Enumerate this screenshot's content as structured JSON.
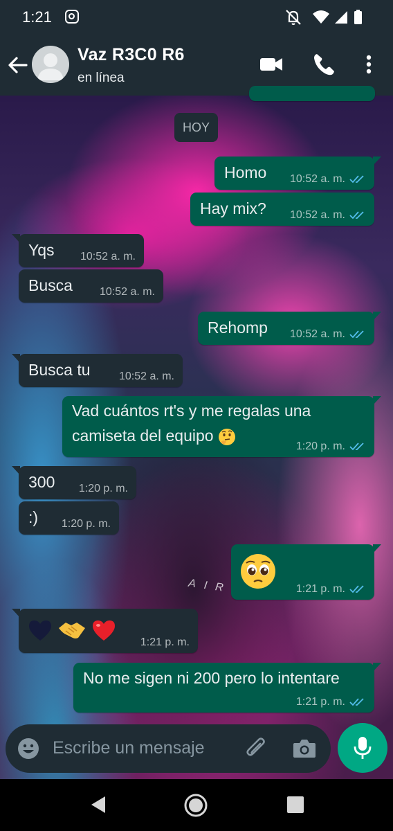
{
  "status_bar": {
    "time": "1:21"
  },
  "header": {
    "contact_name": "Vaz R3C0 R6",
    "contact_status": "en línea"
  },
  "date_chip": "HOY",
  "messages": [
    {
      "dir": "out",
      "text": "Homo",
      "time": "10:52 a. m.",
      "read": true
    },
    {
      "dir": "out",
      "text": "Hay mix?",
      "time": "10:52 a. m.",
      "read": true
    },
    {
      "dir": "in",
      "text": "Yqs",
      "time": "10:52 a. m."
    },
    {
      "dir": "in",
      "text": "Busca",
      "time": "10:52 a. m."
    },
    {
      "dir": "out",
      "text": "Rehomp",
      "time": "10:52 a. m.",
      "read": true
    },
    {
      "dir": "in",
      "text": "Busca tu",
      "time": "10:52 a. m."
    },
    {
      "dir": "out",
      "text_line1": "Vad cuántos rt's y me regalas una",
      "text_line2": "camiseta del equipo",
      "emoji": "thinking-face",
      "time": "1:20 p. m.",
      "read": true
    },
    {
      "dir": "in",
      "text": "300",
      "time": "1:20 p. m."
    },
    {
      "dir": "in",
      "text": ":)",
      "time": "1:20 p. m."
    },
    {
      "dir": "out",
      "emoji": "pleading-face",
      "time": "1:21 p. m.",
      "read": true
    },
    {
      "dir": "in",
      "emojis": [
        "black-heart",
        "handshake",
        "red-heart"
      ],
      "time": "1:21 p. m."
    },
    {
      "dir": "out",
      "text": "No me sigen ni 200 pero lo intentare",
      "time": "1:21 p. m.",
      "read": true
    }
  ],
  "wallpaper_text": "AIR",
  "input": {
    "placeholder": "Escribe un mensaje"
  },
  "colors": {
    "header_bg": "#1f2c34",
    "outgoing_bubble": "#005c4b",
    "incoming_bubble": "#1f2c34",
    "read_ticks": "#53bdeb",
    "mic_button": "#00a884"
  }
}
